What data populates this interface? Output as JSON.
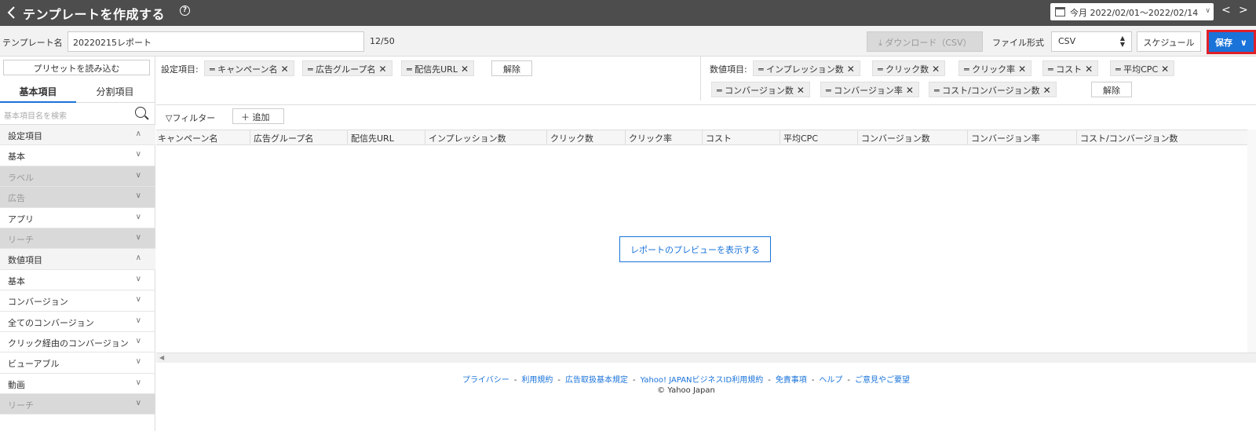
{
  "header": {
    "title": "テンプレートを作成する",
    "help": "?",
    "date_range": "今月 2022/02/01〜2022/02/14",
    "prev": "<",
    "next": ">"
  },
  "toolbar": {
    "name_label": "テンプレート名",
    "name_value": "20220215レポート",
    "name_count": "12/50",
    "download_label": "ダウンロード（CSV）",
    "format_label": "ファイル形式",
    "format_value": "CSV",
    "schedule_label": "スケジュール",
    "save_label": "保存"
  },
  "sidebar": {
    "preset_label": "プリセットを読み込む",
    "tabs": [
      "基本項目",
      "分割項目"
    ],
    "search_placeholder": "基本項目名を検索",
    "items": [
      {
        "label": "設定項目",
        "type": "section",
        "chev": "^"
      },
      {
        "label": "基本",
        "type": "normal",
        "chev": "v"
      },
      {
        "label": "ラベル",
        "type": "disabled",
        "chev": "v"
      },
      {
        "label": "広告",
        "type": "disabled",
        "chev": "v"
      },
      {
        "label": "アプリ",
        "type": "normal",
        "chev": "v"
      },
      {
        "label": "リーチ",
        "type": "disabled",
        "chev": "v"
      },
      {
        "label": "数値項目",
        "type": "section",
        "chev": "^"
      },
      {
        "label": "基本",
        "type": "normal",
        "chev": "v"
      },
      {
        "label": "コンバージョン",
        "type": "normal",
        "chev": "v"
      },
      {
        "label": "全てのコンバージョン",
        "type": "normal",
        "chev": "v"
      },
      {
        "label": "クリック経由のコンバージョン",
        "type": "normal",
        "chev": "v"
      },
      {
        "label": "ビューアブル",
        "type": "normal",
        "chev": "v"
      },
      {
        "label": "動画",
        "type": "normal",
        "chev": "v"
      },
      {
        "label": "リーチ",
        "type": "disabled",
        "chev": "v"
      }
    ]
  },
  "settings": {
    "label": "設定項目:",
    "chips": [
      "キャンペーン名",
      "広告グループ名",
      "配信先URL"
    ],
    "reset_label": "解除"
  },
  "metrics": {
    "label": "数値項目:",
    "chips": [
      "インプレッション数",
      "クリック数",
      "クリック率",
      "コスト",
      "平均CPC",
      "コンバージョン数",
      "コンバージョン率",
      "コスト/コンバージョン数"
    ],
    "reset_label": "解除"
  },
  "filter": {
    "label": "フィルター",
    "add_label": "追加"
  },
  "table": {
    "columns": [
      "キャンペーン名",
      "広告グループ名",
      "配信先URL",
      "インプレッション数",
      "クリック数",
      "クリック率",
      "コスト",
      "平均CPC",
      "コンバージョン数",
      "コンバージョン率",
      "コスト/コンバージョン数"
    ]
  },
  "preview_label": "レポートのプレビューを表示する",
  "footer": {
    "links": [
      "プライバシー",
      "利用規約",
      "広告取扱基本規定",
      "Yahoo! JAPANビジネスID利用規約",
      "免責事項",
      "ヘルプ",
      "ご意見やご要望"
    ],
    "separator": "-",
    "copyright": "© Yahoo Japan"
  },
  "colors": {
    "header_bg": "#4d4d4d",
    "accent": "#1a73d9",
    "highlight": "#e0202a"
  }
}
